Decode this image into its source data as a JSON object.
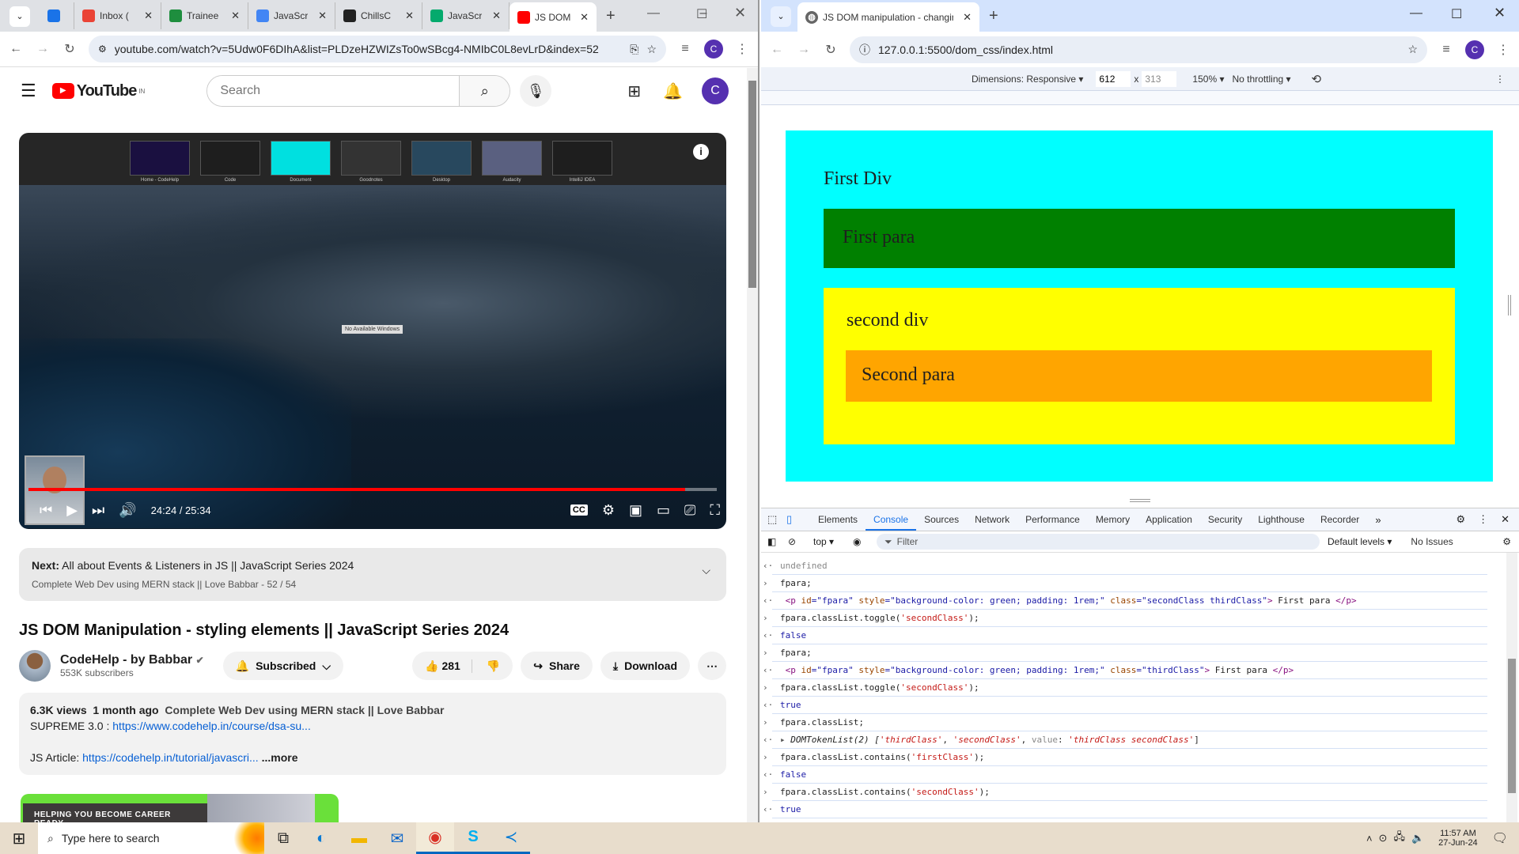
{
  "left_browser": {
    "tabs": [
      {
        "label": "",
        "icon": "copilot-icon",
        "color": "#1a73e8"
      },
      {
        "label": "Inbox (",
        "icon": "gmail-icon",
        "color": "#ea4335"
      },
      {
        "label": "Trainee",
        "icon": "sheets-icon",
        "color": "#1e8e3e"
      },
      {
        "label": "JavaScr",
        "icon": "docs-icon",
        "color": "#4285f4"
      },
      {
        "label": "ChillsC",
        "icon": "github-icon",
        "color": "#222222"
      },
      {
        "label": "JavaScr",
        "icon": "w3schools-icon",
        "color": "#04aa6d"
      },
      {
        "label": "JS DOM",
        "icon": "youtube-icon",
        "color": "#ff0000",
        "active": true
      }
    ],
    "url": "youtube.com/watch?v=5Udw0F6DIhA&list=PLDzeHZWIZsTo0wSBcg4-NMIbC0L8evLrD&index=52",
    "avatar": "C"
  },
  "youtube": {
    "logo": "YouTube",
    "region": "IN",
    "search_placeholder": "Search",
    "avatar": "C",
    "video": {
      "app_switcher": [
        "Home - CodeHelp",
        "Code",
        "Document",
        "Goodnotes",
        "Desktop",
        "Audacity",
        "IntelliJ IDEA"
      ],
      "center_label": "No Available Windows",
      "time": "24:24 / 25:34",
      "progress": 0.954
    },
    "next": {
      "label": "Next:",
      "title": "All about Events & Listeners in JS || JavaScript Series 2024",
      "playlist": "Complete Web Dev using MERN stack || Love Babbar - 52 / 54"
    },
    "title": "JS DOM Manipulation - styling elements || JavaScript Series 2024",
    "channel": {
      "name": "CodeHelp - by Babbar",
      "subscribers": "553K subscribers"
    },
    "subscribed_label": "Subscribed",
    "likes": "281",
    "share_label": "Share",
    "download_label": "Download",
    "description": {
      "views": "6.3K views",
      "age": "1 month ago",
      "playlist": "Complete Web Dev using MERN stack || Love Babbar",
      "line1_prefix": "SUPREME 3.0 : ",
      "line1_link": "https://www.codehelp.in/course/dsa-su...",
      "line2_prefix": "JS Article: ",
      "line2_link": "https://codehelp.in/tutorial/javascri...",
      "more": "...more"
    },
    "ad_banner": "HELPING YOU BECOME CAREER READY"
  },
  "right_browser": {
    "tab_title": "JS DOM manipulation - changin",
    "url": "127.0.0.1:5500/dom_css/index.html",
    "avatar": "C",
    "device_toolbar": {
      "dimensions": "Dimensions: Responsive",
      "width": "612",
      "times": "x",
      "height": "313",
      "zoom": "150%",
      "throttling": "No throttling"
    }
  },
  "page": {
    "first_div": "First Div",
    "first_para": "First para",
    "second_div": "second div",
    "second_para": "Second para",
    "colors": {
      "first_div": "#00ffff",
      "first_para": "#008000",
      "second_div": "#ffff00",
      "second_para": "#ffa500"
    }
  },
  "devtools": {
    "tabs": [
      "Elements",
      "Console",
      "Sources",
      "Network",
      "Performance",
      "Memory",
      "Application",
      "Security",
      "Lighthouse",
      "Recorder"
    ],
    "active_tab": "Console",
    "context": "top",
    "filter_placeholder": "Filter",
    "levels": "Default levels",
    "issues": "No Issues",
    "console": [
      {
        "dir": "out",
        "segs": [
          [
            "undefined",
            "#888"
          ]
        ]
      },
      {
        "dir": "in",
        "segs": [
          [
            "fpara;",
            "#222"
          ]
        ]
      },
      {
        "dir": "out",
        "segs": [
          [
            " <p ",
            "#881280"
          ],
          [
            "id",
            "#994500"
          ],
          [
            "=\"",
            "#1a1aa6"
          ],
          [
            "fpara",
            "#1a1aa6"
          ],
          [
            "\" ",
            "#1a1aa6"
          ],
          [
            "style",
            "#994500"
          ],
          [
            "=\"background-color: green; padding: 1rem;\" ",
            "#1a1aa6"
          ],
          [
            "class",
            "#994500"
          ],
          [
            "=\"secondClass thirdClass\"",
            "#1a1aa6"
          ],
          [
            "> ",
            "#881280"
          ],
          [
            "First para ",
            "#222"
          ],
          [
            "</p>",
            "#881280"
          ]
        ]
      },
      {
        "dir": "in",
        "segs": [
          [
            "fpara.classList.toggle(",
            "#222"
          ],
          [
            "'secondClass'",
            "#c41a16"
          ],
          [
            ");",
            "#222"
          ]
        ]
      },
      {
        "dir": "out",
        "segs": [
          [
            "false",
            "#1a1aa6"
          ]
        ]
      },
      {
        "dir": "in",
        "segs": [
          [
            "fpara;",
            "#222"
          ]
        ]
      },
      {
        "dir": "out",
        "segs": [
          [
            " <p ",
            "#881280"
          ],
          [
            "id",
            "#994500"
          ],
          [
            "=\"fpara\" ",
            "#1a1aa6"
          ],
          [
            "style",
            "#994500"
          ],
          [
            "=\"background-color: green; padding: 1rem;\" ",
            "#1a1aa6"
          ],
          [
            "class",
            "#994500"
          ],
          [
            "=\"thirdClass\"",
            "#1a1aa6"
          ],
          [
            "> ",
            "#881280"
          ],
          [
            "First para ",
            "#222"
          ],
          [
            "</p>",
            "#881280"
          ]
        ]
      },
      {
        "dir": "in",
        "segs": [
          [
            "fpara.classList.toggle(",
            "#222"
          ],
          [
            "'secondClass'",
            "#c41a16"
          ],
          [
            ");",
            "#222"
          ]
        ]
      },
      {
        "dir": "out",
        "segs": [
          [
            "true",
            "#1a1aa6"
          ]
        ]
      },
      {
        "dir": "in",
        "segs": [
          [
            "fpara.classList;",
            "#222"
          ]
        ]
      },
      {
        "dir": "out",
        "segs": [
          [
            "▸ ",
            "#555"
          ],
          [
            "DOMTokenList(2) [",
            "#222"
          ],
          [
            "'thirdClass'",
            "#c41a16"
          ],
          [
            ", ",
            "#222"
          ],
          [
            "'secondClass'",
            "#c41a16"
          ],
          [
            ", ",
            "#222"
          ],
          [
            "value",
            "#888"
          ],
          [
            ": ",
            "#222"
          ],
          [
            "'thirdClass secondClass'",
            "#c41a16"
          ],
          [
            "]",
            "#222"
          ]
        ]
      },
      {
        "dir": "in",
        "segs": [
          [
            "fpara.classList.contains(",
            "#222"
          ],
          [
            "'firstClass'",
            "#c41a16"
          ],
          [
            ");",
            "#222"
          ]
        ]
      },
      {
        "dir": "out",
        "segs": [
          [
            "false",
            "#1a1aa6"
          ]
        ]
      },
      {
        "dir": "in",
        "segs": [
          [
            "fpara.classList.contains(",
            "#222"
          ],
          [
            "'secondClass'",
            "#c41a16"
          ],
          [
            ");",
            "#222"
          ]
        ]
      },
      {
        "dir": "out",
        "segs": [
          [
            "true",
            "#1a1aa6"
          ]
        ]
      }
    ]
  },
  "taskbar": {
    "search_placeholder": "Type here to search",
    "time": "11:57 AM",
    "date": "27-Jun-24"
  }
}
